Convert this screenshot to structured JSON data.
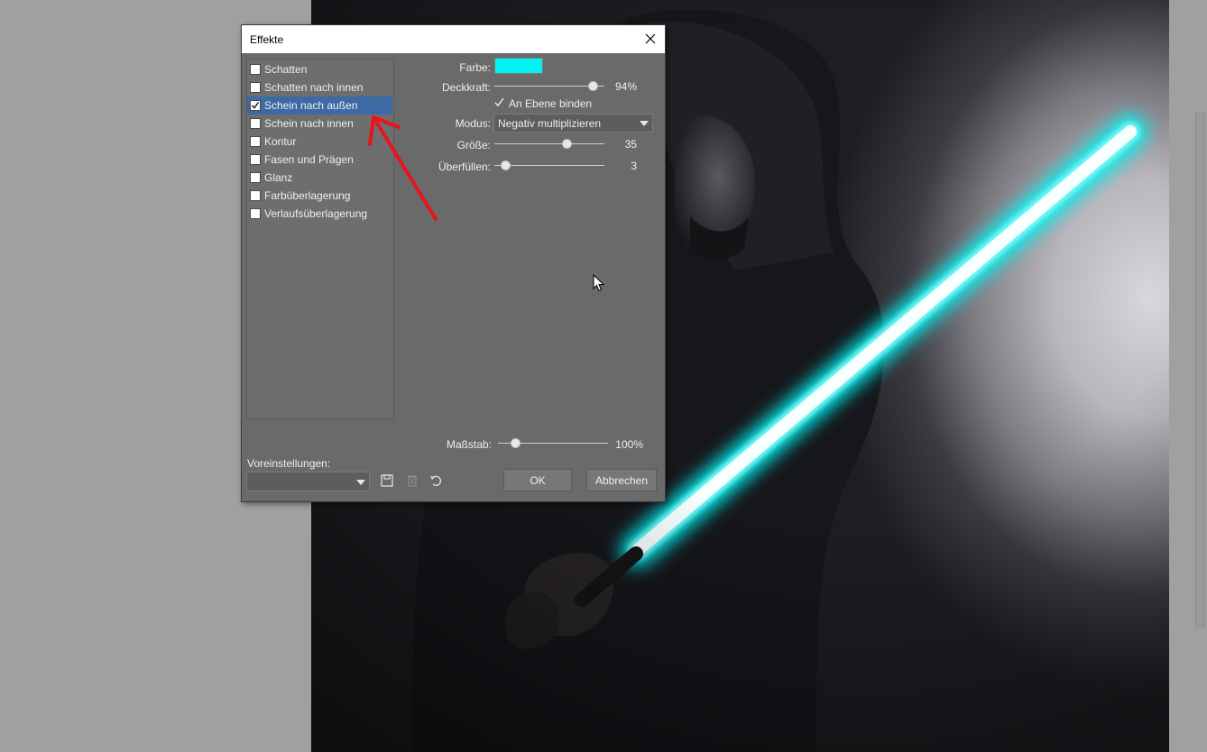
{
  "dialog": {
    "title": "Effekte",
    "effects": [
      {
        "label": "Schatten",
        "checked": false,
        "selected": false
      },
      {
        "label": "Schatten nach innen",
        "checked": false,
        "selected": false
      },
      {
        "label": "Schein nach außen",
        "checked": true,
        "selected": true
      },
      {
        "label": "Schein nach innen",
        "checked": false,
        "selected": false
      },
      {
        "label": "Kontur",
        "checked": false,
        "selected": false
      },
      {
        "label": "Fasen und Prägen",
        "checked": false,
        "selected": false
      },
      {
        "label": "Glanz",
        "checked": false,
        "selected": false
      },
      {
        "label": "Farbüberlagerung",
        "checked": false,
        "selected": false
      },
      {
        "label": "Verlaufsüberlagerung",
        "checked": false,
        "selected": false
      }
    ],
    "params": {
      "color_label": "Farbe:",
      "color_value": "#00f2f2",
      "opacity_label": "Deckkraft:",
      "opacity_value": "94%",
      "opacity_fraction": 0.94,
      "bind_label": "An Ebene binden",
      "bind_checked": true,
      "mode_label": "Modus:",
      "mode_value": "Negativ multiplizieren",
      "size_label": "Größe:",
      "size_value": "35",
      "size_fraction": 0.68,
      "fill_label": "Überfüllen:",
      "fill_value": "3",
      "fill_fraction": 0.06
    },
    "scale_label": "Maßstab:",
    "scale_value": "100%",
    "scale_fraction": 0.13,
    "presets_label": "Voreinstellungen:",
    "presets_value": "",
    "ok_label": "OK",
    "cancel_label": "Abbrechen"
  },
  "colors": {
    "selection": "#3d6aa5",
    "glow": "#00f2f2",
    "annotation_arrow": "#e8141a"
  }
}
